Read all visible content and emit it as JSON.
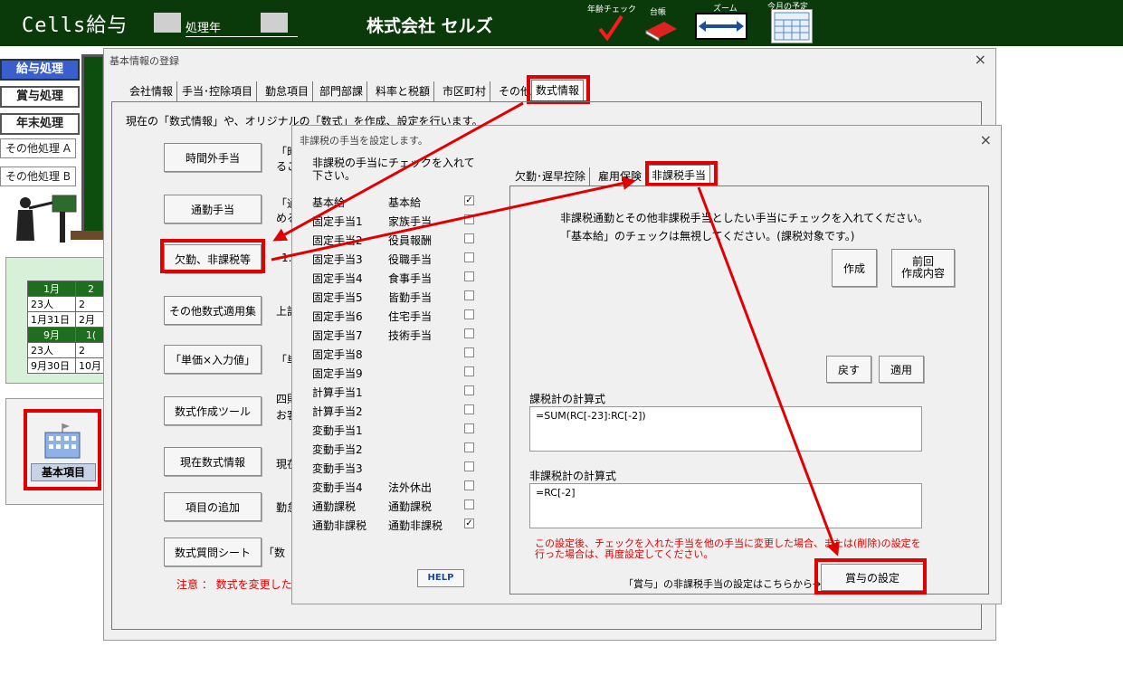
{
  "topbar": {
    "app_title": "Cells給与",
    "year_label": "処理年",
    "company": "株式会社 セルズ",
    "age_check_label": "年齢チェック",
    "ledger_label": "台帳",
    "zoom_label": "ズーム",
    "schedule_label": "今月の予定"
  },
  "left_menu": {
    "items": [
      "給与処理",
      "賞与処理",
      "年末処理",
      "その他処理 A",
      "その他処理 B"
    ]
  },
  "calendar": {
    "rows": [
      [
        "1月",
        "2"
      ],
      [
        "23人",
        "2"
      ],
      [
        "1月31日",
        "2月"
      ],
      [
        "9月",
        "1("
      ],
      [
        "23人",
        "2"
      ],
      [
        "9月30日",
        "10月"
      ]
    ]
  },
  "basic_item_button": "基本項目",
  "main_window": {
    "title": "基本情報の登録",
    "tabs": [
      "会社情報",
      "手当･控除項目",
      "勤怠項目",
      "部門部課",
      "料率と税額",
      "市区町村",
      "その他",
      "数式情報"
    ],
    "description": "現在の「数式情報」や、オリジナルの「数式」を作成、設定を行います。",
    "buttons": [
      {
        "label": "時間外手当",
        "desc": "「時\nるこ"
      },
      {
        "label": "通勤手当",
        "desc": "「通\nめる"
      },
      {
        "label": "欠勤、非課税等",
        "desc": "1."
      },
      {
        "label": "その他数式適用集",
        "desc": "上記"
      },
      {
        "label": "「単価×入力値」",
        "desc": "「単"
      },
      {
        "label": "数式作成ツール",
        "desc": "四則\nお客"
      },
      {
        "label": "現在数式情報",
        "desc": "現在"
      },
      {
        "label": "項目の追加",
        "desc": "勤怠"
      },
      {
        "label": "数式質問シート",
        "desc": "「数"
      }
    ],
    "note": "注意 ： 数式を変更した"
  },
  "dialog": {
    "title": "非課税の手当を設定します。",
    "instruction": "非課税の手当にチェックを入れて下さい。",
    "items": [
      {
        "code": "基本給",
        "name": "基本給",
        "checked": true
      },
      {
        "code": "固定手当1",
        "name": "家族手当",
        "checked": false
      },
      {
        "code": "固定手当2",
        "name": "役員報酬",
        "checked": false
      },
      {
        "code": "固定手当3",
        "name": "役職手当",
        "checked": false
      },
      {
        "code": "固定手当4",
        "name": "食事手当",
        "checked": false
      },
      {
        "code": "固定手当5",
        "name": "皆勤手当",
        "checked": false
      },
      {
        "code": "固定手当6",
        "name": "住宅手当",
        "checked": false
      },
      {
        "code": "固定手当7",
        "name": "技術手当",
        "checked": false
      },
      {
        "code": "固定手当8",
        "name": "",
        "checked": false
      },
      {
        "code": "固定手当9",
        "name": "",
        "checked": false
      },
      {
        "code": "計算手当1",
        "name": "",
        "checked": false
      },
      {
        "code": "計算手当2",
        "name": "",
        "checked": false
      },
      {
        "code": "変動手当1",
        "name": "",
        "checked": false
      },
      {
        "code": "変動手当2",
        "name": "",
        "checked": false
      },
      {
        "code": "変動手当3",
        "name": "",
        "checked": false
      },
      {
        "code": "変動手当4",
        "name": "法外休出",
        "checked": false
      },
      {
        "code": "通勤課税",
        "name": "通勤課税",
        "checked": false
      },
      {
        "code": "通勤非課税",
        "name": "通勤非課税",
        "checked": true
      }
    ],
    "help": "HELP",
    "tabs": [
      "欠勤･遅早控除",
      "雇用保険",
      "非課税手当"
    ],
    "panel_text_1": "非課税通勤とその他非課税手当としたい手当にチェックを入れてください。",
    "panel_text_2": "「基本給」のチェックは無視してください。(課税対象です。)",
    "create_button": "作成",
    "prev_button_1": "前回",
    "prev_button_2": "作成内容",
    "back_button": "戻す",
    "apply_button": "適用",
    "taxable_label": "課税計の計算式",
    "taxable_formula": "=SUM(RC[-23]:RC[-2])",
    "nontaxable_label": "非課税計の計算式",
    "nontaxable_formula": "=RC[-2]",
    "warning_1": "この設定後、チェックを入れた手当を他の手当に変更した場合、または(削除)の設定を",
    "warning_2": "行った場合は、再度設定してください。",
    "bonus_text": "「賞与」の非課税手当の設定はこちらから→",
    "bonus_button": "賞与の設定"
  },
  "colors": {
    "topbar": "#0a3a0a",
    "highlight": "#e00000",
    "active_menu": "#3a5fcd",
    "warning_text": "#e00000"
  }
}
